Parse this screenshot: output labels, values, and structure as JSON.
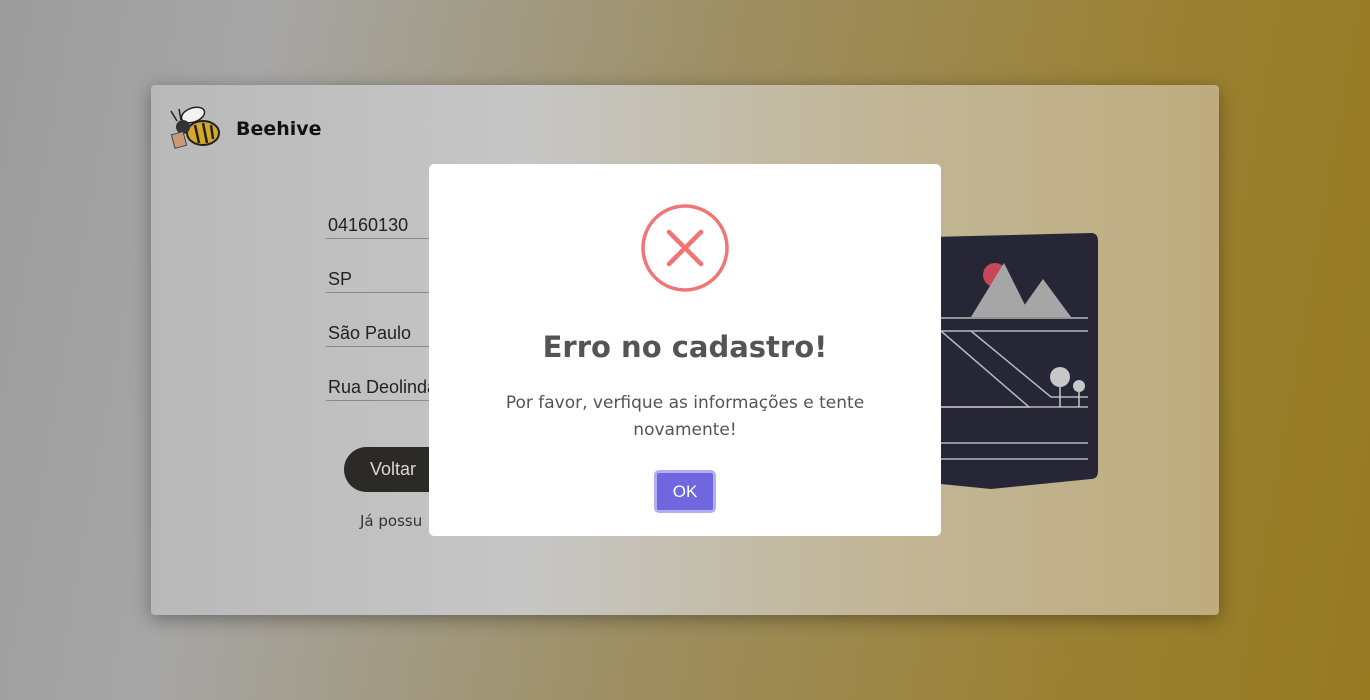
{
  "app": {
    "brand": "Beehive"
  },
  "form": {
    "cep": "04160130",
    "uf": "SP",
    "cidade": "São Paulo",
    "rua": "Rua Deolinda"
  },
  "buttons": {
    "back_label": "Voltar"
  },
  "login_prompt": "Já possu",
  "modal": {
    "title": "Erro no cadastro!",
    "message": "Por favor, verfique as informações e tente novamente!",
    "ok_label": "OK",
    "icon": "error-x-icon"
  },
  "colors": {
    "error": "#f27474",
    "confirm": "#7066e0",
    "back_button": "#2b2a27"
  }
}
